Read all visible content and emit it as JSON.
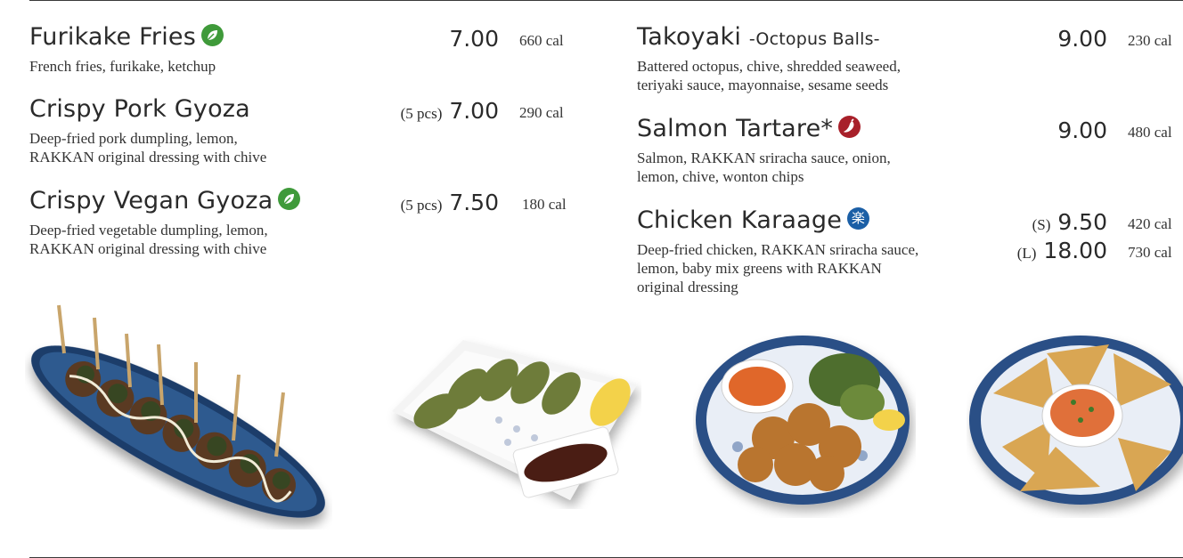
{
  "left": {
    "items": [
      {
        "name": "Furikake Fries",
        "qty": "",
        "price": "7.00",
        "cal": "660 cal",
        "desc": [
          "French fries, furikake, ketchup"
        ],
        "badge": "vegan-leaf-icon"
      },
      {
        "name": "Crispy Pork Gyoza",
        "qty": "(5 pcs)",
        "price": "7.00",
        "cal": "290 cal",
        "desc": [
          "Deep-fried pork dumpling, lemon,",
          "RAKKAN original dressing with chive"
        ],
        "badge": ""
      },
      {
        "name": "Crispy Vegan Gyoza",
        "qty": "(5 pcs)",
        "price": "7.50",
        "cal": "180 cal",
        "desc": [
          "Deep-fried vegetable dumpling, lemon,",
          "RAKKAN original dressing with chive"
        ],
        "badge": "vegan-leaf-icon"
      }
    ]
  },
  "right": {
    "items": [
      {
        "name": "Takoyaki",
        "sub": "-Octopus Balls-",
        "price": "9.00",
        "cal": "230 cal",
        "desc": [
          "Battered octopus, chive, shredded seaweed,",
          "teriyaki sauce, mayonnaise, sesame seeds"
        ]
      },
      {
        "name": "Salmon Tartare*",
        "price": "9.00",
        "cal": "480 cal",
        "desc": [
          "Salmon, RAKKAN sriracha sauce, onion,",
          "lemon, chive, wonton chips"
        ],
        "badge": "spicy-pepper-icon"
      },
      {
        "name": "Chicken Karaage",
        "price_s_qty": "(S)",
        "price_s": "9.50",
        "cal_s": "420 cal",
        "price_l_qty": "(L)",
        "price_l": "18.00",
        "cal_l": "730 cal",
        "desc": [
          "Deep-fried chicken, RAKKAN sriracha sauce,",
          "lemon, baby mix greens with RAKKAN",
          "original dressing"
        ],
        "badge": "rakkan-signature-icon",
        "badge_char": "楽"
      }
    ]
  },
  "colors": {
    "vegan": "#3f9a3a",
    "spicy": "#a8202a",
    "signature": "#1b5fa6"
  }
}
